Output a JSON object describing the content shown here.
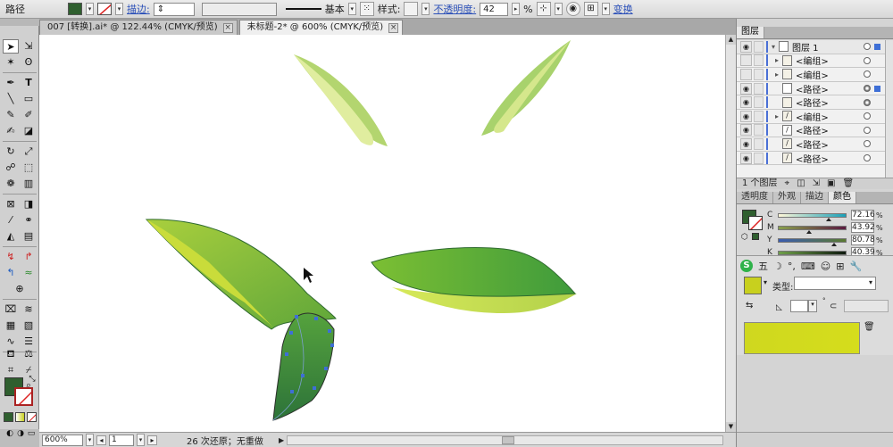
{
  "control_bar": {
    "object_label": "路径",
    "fill_color": "#2f5f2f",
    "stroke_label": "描边:",
    "stroke_profile": "基本",
    "style_label": "样式:",
    "opacity_label": "不透明度:",
    "opacity_value": "42",
    "opacity_unit": "%",
    "transform_label": "变换"
  },
  "tabs": [
    {
      "label": "007 [转换].ai* @ 122.44% (CMYK/预览)"
    },
    {
      "label": "未标题-2* @ 600% (CMYK/预览)"
    }
  ],
  "toolbox": {
    "fill_color": "#2f5f2f",
    "tools": [
      "selection-tool",
      "direct-selection-tool",
      "magic-wand-tool",
      "lasso-tool",
      "pen-tool",
      "type-tool",
      "line-tool",
      "rectangle-tool",
      "paintbrush-tool",
      "pencil-tool",
      "blob-brush-tool",
      "eraser-tool",
      "rotate-tool",
      "scale-tool",
      "warp-tool",
      "free-transform-tool",
      "symbol-sprayer-tool",
      "column-graph-tool",
      "mesh-tool",
      "gradient-tool",
      "eyedropper-tool",
      "blend-tool",
      "live-paint-tool",
      "live-paint-selection-tool",
      "crop-tool",
      "slice-tool",
      "hand-tool",
      "zoom-tool"
    ]
  },
  "status": {
    "zoom": "600%",
    "artboard": "1",
    "message": "26 次还原；无重做"
  },
  "layers_panel": {
    "tab_label": "图层",
    "rows": [
      {
        "name": "图层 1",
        "eye": true,
        "expanded": true,
        "level": 0,
        "target": "empty",
        "selected": true
      },
      {
        "name": "<编组>",
        "eye": false,
        "expanded": false,
        "level": 1,
        "target": "empty",
        "selected": false
      },
      {
        "name": "<编组>",
        "eye": false,
        "expanded": false,
        "level": 1,
        "target": "empty",
        "selected": false
      },
      {
        "name": "<路径>",
        "eye": true,
        "expanded": null,
        "level": 1,
        "target": "fill",
        "selected": true
      },
      {
        "name": "<路径>",
        "eye": true,
        "expanded": null,
        "level": 1,
        "target": "fill",
        "selected": false
      },
      {
        "name": "<编组>",
        "eye": true,
        "expanded": false,
        "level": 1,
        "target": "empty",
        "selected": false
      },
      {
        "name": "<路径>",
        "eye": true,
        "expanded": null,
        "level": 1,
        "target": "empty",
        "selected": false
      },
      {
        "name": "<路径>",
        "eye": true,
        "expanded": null,
        "level": 1,
        "target": "empty",
        "selected": false
      },
      {
        "name": "<路径>",
        "eye": true,
        "expanded": null,
        "level": 1,
        "target": "empty",
        "selected": false
      }
    ],
    "footer": "1 个图层"
  },
  "color_panel": {
    "tabs": [
      "透明度",
      "外观",
      "描边",
      "颜色"
    ],
    "active_tab": "颜色",
    "channels": [
      {
        "label": "C",
        "value": "72.16",
        "grad": "linear-gradient(90deg,#fff7d8,#1aa0b8)"
      },
      {
        "label": "M",
        "value": "43.92",
        "grad": "linear-gradient(90deg,#88a04c,#5b1a40)"
      },
      {
        "label": "Y",
        "value": "80.78",
        "grad": "linear-gradient(90deg,#3a5cb0,#5a7a30)"
      },
      {
        "label": "K",
        "value": "40.39",
        "grad": "linear-gradient(90deg,#6fa04a,#0e1a0e)"
      }
    ],
    "unit": "%"
  },
  "swatch_panel": {
    "type_label": "类型:",
    "type_value": "",
    "color": "#c8d01e"
  }
}
